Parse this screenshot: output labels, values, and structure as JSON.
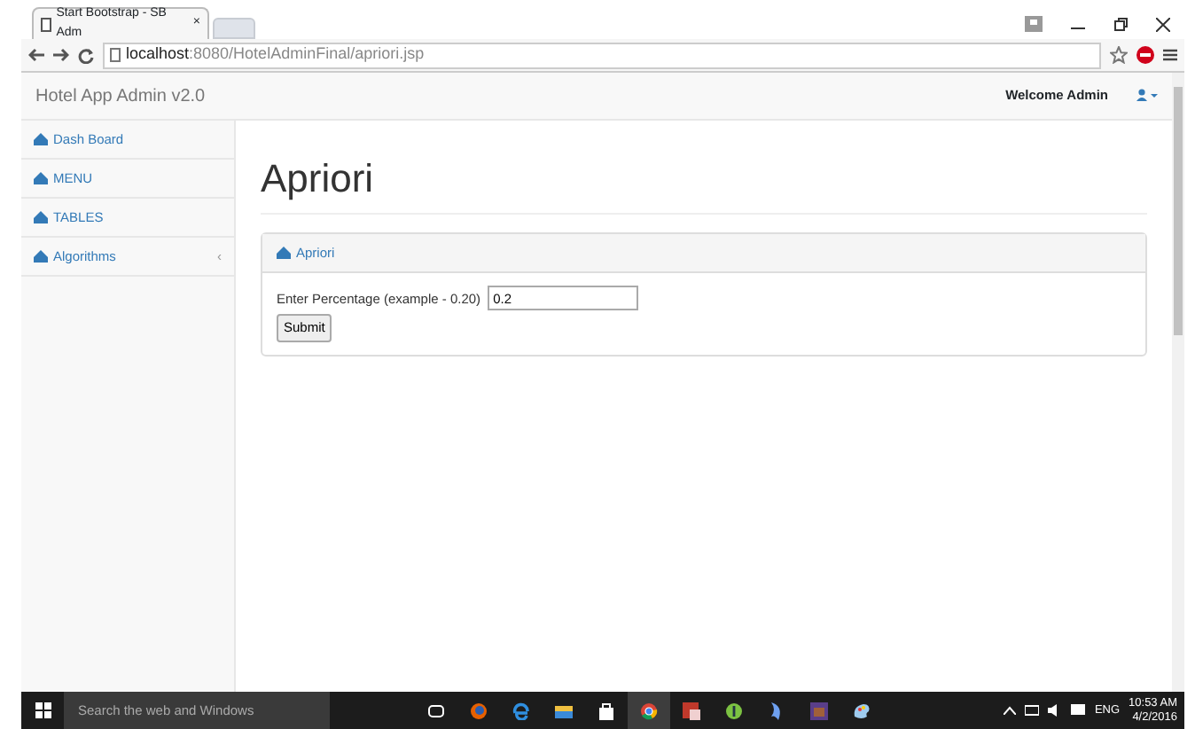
{
  "browser": {
    "tab_title": "Start Bootstrap - SB Adm",
    "tab_close": "×",
    "url_host": "localhost",
    "url_rest": ":8080/HotelAdminFinal/apriori.jsp"
  },
  "navbar": {
    "brand": "Hotel App Admin v2.0",
    "user": "Welcome Admin"
  },
  "sidebar": {
    "items": [
      {
        "label": "Dash Board"
      },
      {
        "label": "MENU"
      },
      {
        "label": "TABLES"
      },
      {
        "label": "Algorithms",
        "caret": "‹"
      }
    ]
  },
  "page": {
    "title": "Apriori",
    "panel_title": "Apriori",
    "field_label": "Enter Percentage (example - 0.20)",
    "field_value": "0.2",
    "button": "Submit"
  },
  "taskbar": {
    "search_placeholder": "Search the web and Windows",
    "apps": [
      {
        "kind": "taskview",
        "selected": false
      },
      {
        "kind": "firefox",
        "selected": false
      },
      {
        "kind": "edge",
        "selected": false
      },
      {
        "kind": "folder",
        "selected": false
      },
      {
        "kind": "store",
        "selected": false
      },
      {
        "kind": "chrome",
        "selected": true
      },
      {
        "kind": "red",
        "selected": false
      },
      {
        "kind": "green",
        "selected": false
      },
      {
        "kind": "blue",
        "selected": false
      },
      {
        "kind": "purple",
        "selected": false
      },
      {
        "kind": "paint",
        "selected": false
      }
    ],
    "language": "ENG",
    "time": "10:53 AM",
    "date": "4/2/2016"
  }
}
